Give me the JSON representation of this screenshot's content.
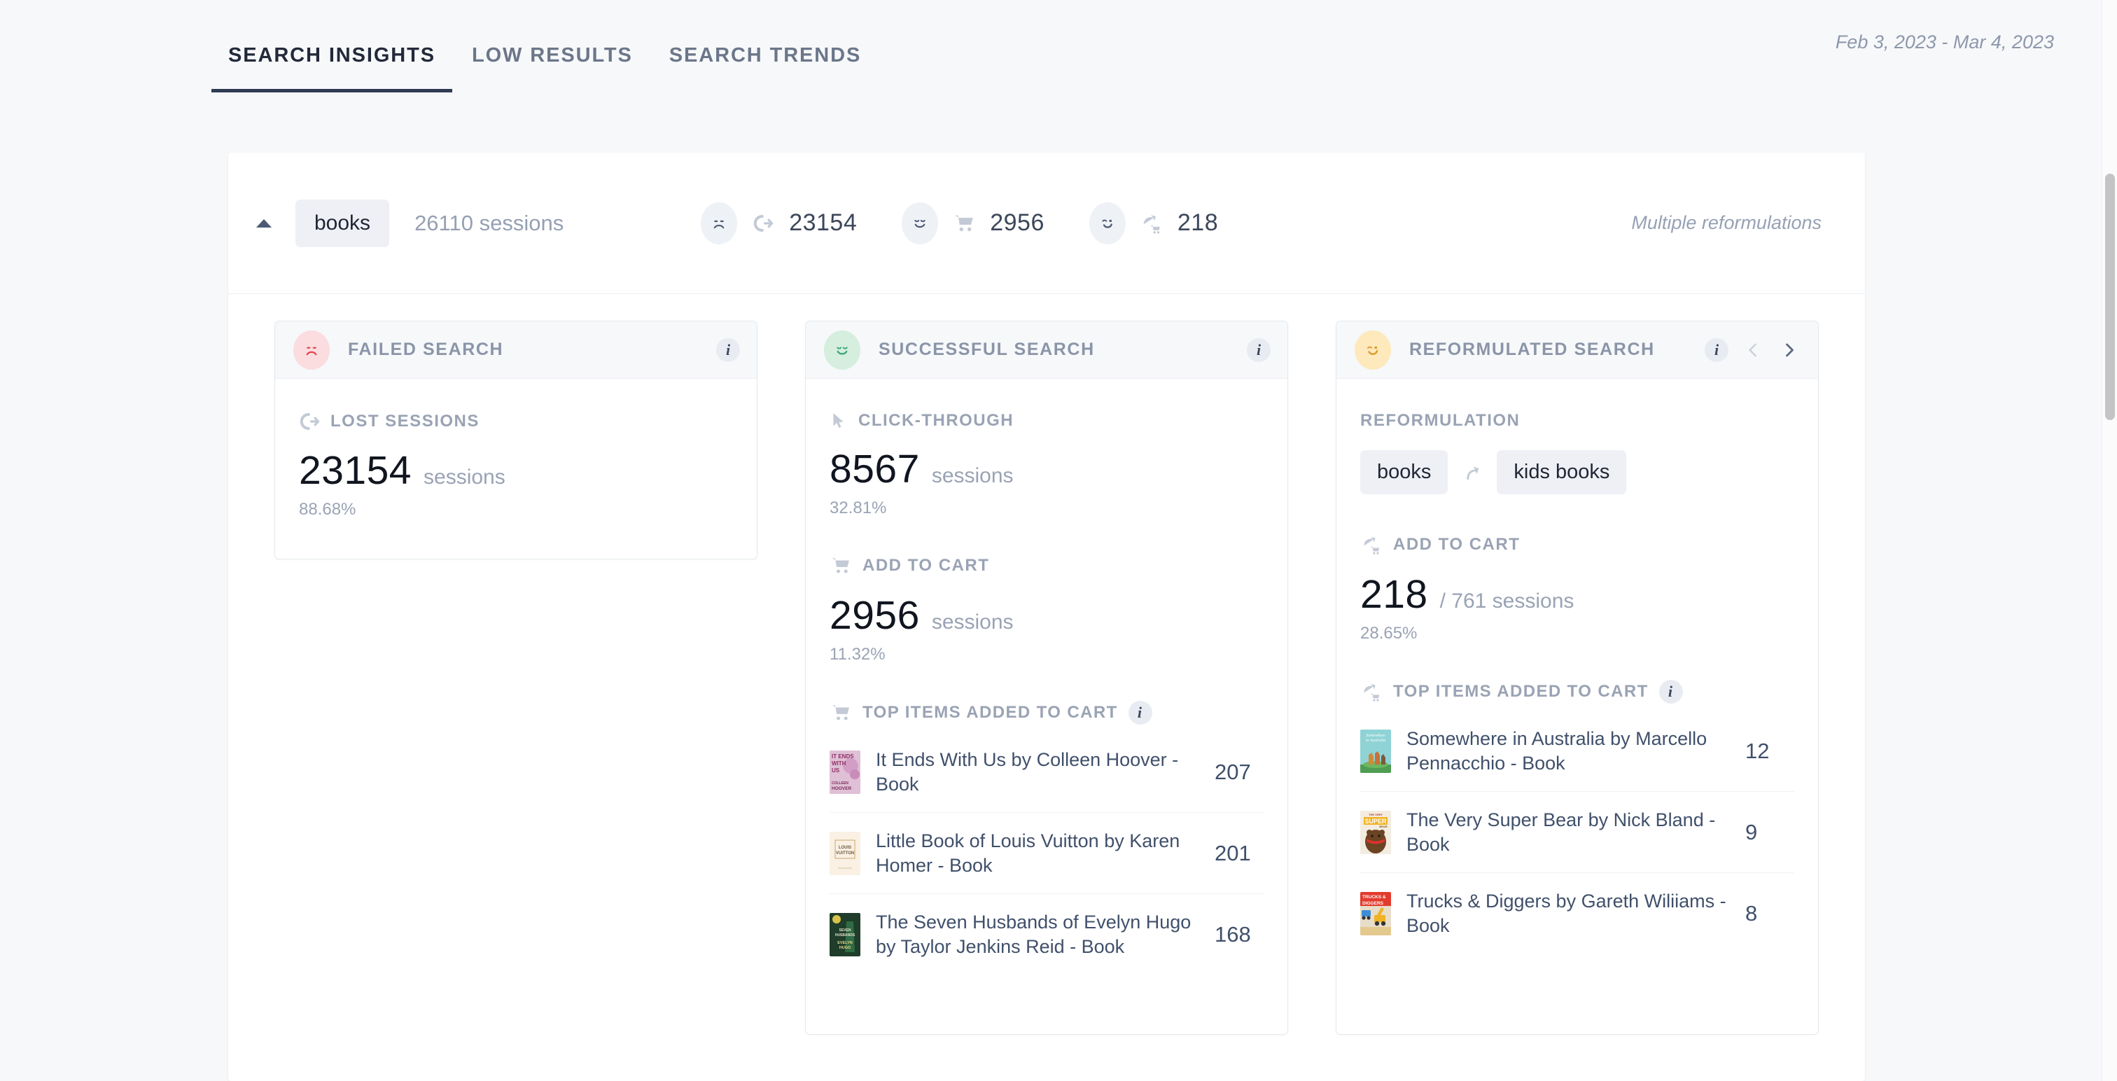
{
  "tabs": [
    {
      "label": "SEARCH INSIGHTS",
      "active": true
    },
    {
      "label": "LOW RESULTS",
      "active": false
    },
    {
      "label": "SEARCH TRENDS",
      "active": false
    }
  ],
  "date_range": "Feb 3, 2023 - Mar 4, 2023",
  "summary": {
    "query_chip": "books",
    "sessions_total": "26110 sessions",
    "metrics": [
      {
        "face": "sad-face-icon",
        "icon": "lost-sessions-icon",
        "value": "23154"
      },
      {
        "face": "smiley-face-icon",
        "icon": "cart-icon",
        "value": "2956"
      },
      {
        "face": "wink-face-icon",
        "icon": "reformulated-cart-icon",
        "value": "218"
      }
    ],
    "multiple_reformulations": "Multiple reformulations"
  },
  "cards": {
    "failed": {
      "title": "FAILED SEARCH",
      "info": "i",
      "metric_label": "LOST SESSIONS",
      "value": "23154",
      "unit": "sessions",
      "percent": "88.68%"
    },
    "success": {
      "title": "SUCCESSFUL SEARCH",
      "info": "i",
      "clickthrough": {
        "label": "CLICK-THROUGH",
        "value": "8567",
        "unit": "sessions",
        "percent": "32.81%"
      },
      "addtocart": {
        "label": "ADD TO CART",
        "value": "2956",
        "unit": "sessions",
        "percent": "11.32%"
      },
      "top_items_label": "TOP ITEMS ADDED TO CART",
      "top_items_info": "i",
      "items": [
        {
          "title": "It Ends With Us by Colleen Hoover - Book",
          "count": "207",
          "cover": "it-ends-with-us"
        },
        {
          "title": "Little Book of Louis Vuitton by Karen Homer - Book",
          "count": "201",
          "cover": "louis-vuitton"
        },
        {
          "title": "The Seven Husbands of Evelyn Hugo by Taylor Jenkins Reid - Book",
          "count": "168",
          "cover": "evelyn-hugo"
        }
      ]
    },
    "reform": {
      "title": "REFORMULATED SEARCH",
      "info": "i",
      "reformulation_label": "REFORMULATION",
      "from_chip": "books",
      "to_chip": "kids books",
      "addtocart": {
        "label": "ADD TO CART",
        "value": "218",
        "unit": "/ 761 sessions",
        "percent": "28.65%"
      },
      "top_items_label": "TOP ITEMS ADDED TO CART",
      "top_items_info": "i",
      "items": [
        {
          "title": "Somewhere in Australia by Marcello Pennacchio - Book",
          "count": "12",
          "cover": "somewhere-australia"
        },
        {
          "title": "The Very Super Bear by Nick Bland - Book",
          "count": "9",
          "cover": "super-bear"
        },
        {
          "title": "Trucks & Diggers by Gareth Wiliiams - Book",
          "count": "8",
          "cover": "trucks-diggers"
        }
      ]
    }
  },
  "colors": {
    "accent_dark": "#2f3b52",
    "failed": "#e4434f",
    "success": "#3fa97a",
    "reform": "#e6a33a",
    "muted": "#9aa3b4"
  }
}
